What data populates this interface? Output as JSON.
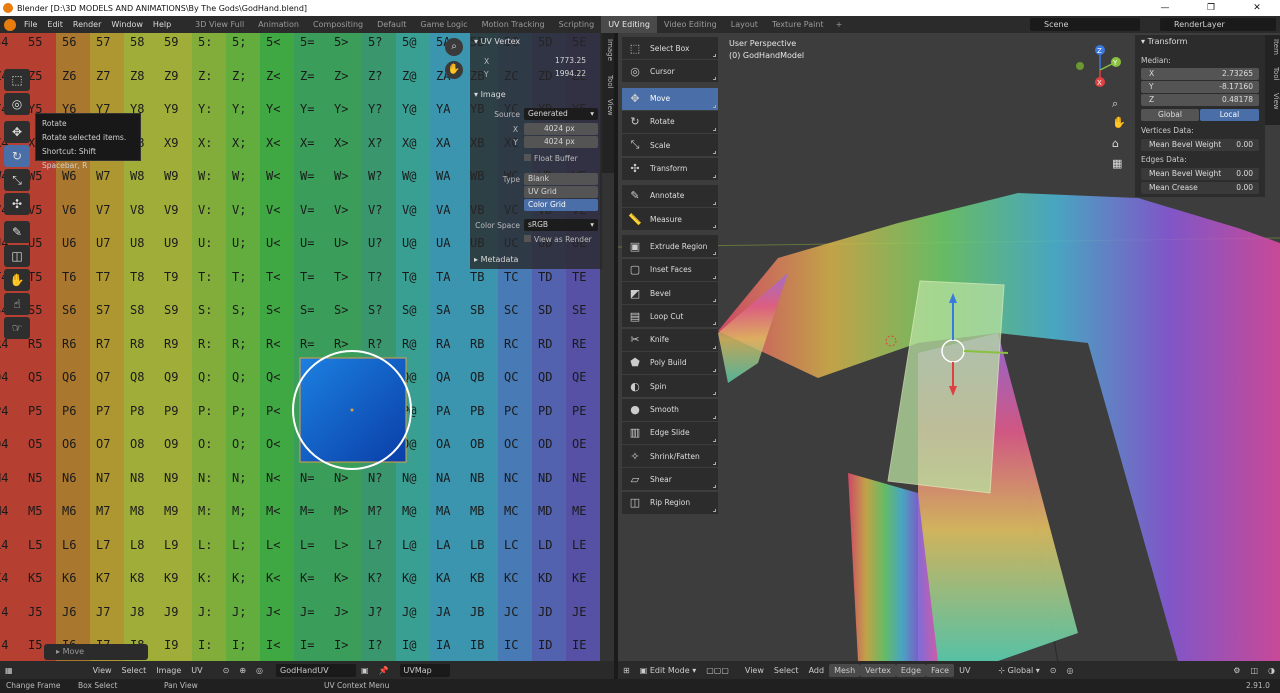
{
  "window": {
    "title": "Blender [D:\\3D MODELS AND ANIMATIONS\\By The Gods\\GodHand.blend]",
    "minimize": "—",
    "maximize": "❐",
    "close": "✕"
  },
  "menubar": [
    "File",
    "Edit",
    "Render",
    "Window",
    "Help"
  ],
  "workspaces": [
    "3D View Full",
    "Animation",
    "Compositing",
    "Default",
    "Game Logic",
    "Motion Tracking",
    "Scripting",
    "UV Editing",
    "Video Editing",
    "Layout",
    "Texture Paint"
  ],
  "active_workspace": "UV Editing",
  "add_workspace": "+",
  "scene": "Scene",
  "render_layer": "RenderLayer",
  "uv_grid": {
    "columns": [
      "4",
      "5",
      "6",
      "7",
      "8",
      "9",
      ":",
      ";",
      "<",
      "=",
      ">",
      "?",
      "@",
      "A",
      "B",
      "C",
      "D",
      "E"
    ],
    "rows": [
      "5",
      "Z",
      "Y",
      "X",
      "W",
      "V",
      "U",
      "T",
      "S",
      "R",
      "Q",
      "P",
      "O",
      "N",
      "M",
      "L",
      "K",
      "J",
      "I"
    ],
    "colors": [
      "#c04030",
      "#b47d2e",
      "#b8a030",
      "#a9b83a",
      "#8ab73b",
      "#66b73f",
      "#41b244",
      "#3ba75d",
      "#3b9e72",
      "#3aa89a",
      "#3c9dba",
      "#4a80c0",
      "#5566b8",
      "#5a54b0"
    ]
  },
  "uv_tools": {
    "tooltip": {
      "title": "Rotate",
      "desc": "Rotate selected items.",
      "shortcut": "Shortcut: Shift Spacebar, R"
    }
  },
  "uv_npanel": {
    "uv_vertex": {
      "title": "UV Vertex",
      "x_label": "X",
      "x": "1773.25",
      "y_label": "Y",
      "y": "1994.22"
    },
    "image": {
      "title": "Image",
      "source_label": "Source",
      "source": "Generated",
      "x_label": "X",
      "width": "4024 px",
      "y_label": "Y",
      "height": "4024 px",
      "float_buffer": "Float Buffer",
      "type_label": "Type",
      "types": [
        "Blank",
        "UV Grid",
        "Color Grid"
      ],
      "selected_type": "Color Grid",
      "color_space_label": "Color Space",
      "color_space": "sRGB",
      "view_as_render": "View as Render"
    },
    "metadata": "Metadata",
    "tabs": [
      "Image",
      "Tool",
      "View"
    ]
  },
  "uv_header": {
    "view": "View",
    "select": "Select",
    "image": "Image",
    "uv": "UV",
    "image_name": "GodHandUV",
    "uvmap": "UVMap"
  },
  "move_panel": "Move",
  "viewport": {
    "perspective": "User Perspective",
    "object": "(0) GodHandModel",
    "tools": [
      {
        "label": "Select Box",
        "icon": "⬚"
      },
      {
        "label": "Cursor",
        "icon": "◎"
      },
      {
        "label": "Move",
        "icon": "✥"
      },
      {
        "label": "Rotate",
        "icon": "↻"
      },
      {
        "label": "Scale",
        "icon": "⤡"
      },
      {
        "label": "Transform",
        "icon": "✣"
      },
      {
        "label": "Annotate",
        "icon": "✎"
      },
      {
        "label": "Measure",
        "icon": "📏"
      },
      {
        "label": "Extrude Region",
        "icon": "▣"
      },
      {
        "label": "Inset Faces",
        "icon": "▢"
      },
      {
        "label": "Bevel",
        "icon": "◩"
      },
      {
        "label": "Loop Cut",
        "icon": "▤"
      },
      {
        "label": "Knife",
        "icon": "✂"
      },
      {
        "label": "Poly Build",
        "icon": "⬟"
      },
      {
        "label": "Spin",
        "icon": "◐"
      },
      {
        "label": "Smooth",
        "icon": "●"
      },
      {
        "label": "Edge Slide",
        "icon": "▥"
      },
      {
        "label": "Shrink/Fatten",
        "icon": "✧"
      },
      {
        "label": "Shear",
        "icon": "▱"
      },
      {
        "label": "Rip Region",
        "icon": "◫"
      }
    ],
    "selected_tool": "Move",
    "gizmo": {
      "x": "X",
      "y": "Y",
      "z": "Z"
    },
    "transform": {
      "title": "Transform",
      "median": "Median:",
      "x_label": "X",
      "x": "2.73265",
      "y_label": "Y",
      "y": "-8.17160",
      "z_label": "Z",
      "z": "0.48178",
      "global": "Global",
      "local": "Local",
      "vertices_data": "Vertices Data:",
      "mean_bevel_weight_label": "Mean Bevel Weight",
      "v_bevel": "0.00",
      "edges_data": "Edges Data:",
      "e_bevel": "0.00",
      "mean_crease_label": "Mean Crease",
      "crease": "0.00"
    },
    "side_tabs": [
      "Item",
      "Tool",
      "View"
    ]
  },
  "viewport_header": {
    "mode": "Edit Mode",
    "view": "View",
    "select": "Select",
    "add": "Add",
    "mesh": "Mesh",
    "vertex": "Vertex",
    "edge": "Edge",
    "face": "Face",
    "uv": "UV",
    "orientation": "Global"
  },
  "statusbar": {
    "change_frame": "Change Frame",
    "box_select": "Box Select",
    "pan_view": "Pan View",
    "context_menu": "UV Context Menu",
    "version": "2.91.0"
  }
}
